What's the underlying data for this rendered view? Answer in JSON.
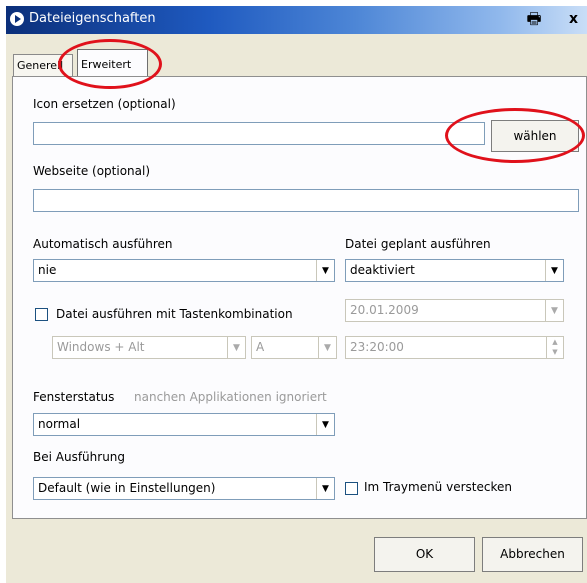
{
  "window": {
    "title": "Dateieigenschaften"
  },
  "tabs": {
    "general": "Generell",
    "advanced": "Erweitert"
  },
  "icon": {
    "label": "Icon ersetzen (optional)",
    "value": "",
    "choose_button": "wählen"
  },
  "website": {
    "label": "Webseite (optional)",
    "value": ""
  },
  "autorun": {
    "label": "Automatisch ausführen",
    "selected": "nie"
  },
  "scheduled": {
    "label": "Datei geplant ausführen",
    "selected": "deaktiviert",
    "date": "20.01.2009",
    "time": "23:20:00"
  },
  "hotkey": {
    "label": "Datei ausführen mit Tastenkombination",
    "modifier": "Windows + Alt",
    "key": "A",
    "checked": false
  },
  "window_state": {
    "label": "Fensterstatus",
    "hint": "nanchen Applikationen ignoriert",
    "selected": "normal"
  },
  "on_execute": {
    "label": "Bei Ausführung",
    "selected": "Default (wie in Einstellungen)"
  },
  "tray": {
    "label": "Im Traymenü verstecken",
    "checked": false
  },
  "buttons": {
    "ok": "OK",
    "cancel": "Abbrechen"
  },
  "icons": {
    "title_logo": "app-logo-icon",
    "print": "printer-icon",
    "close": "close-icon",
    "dropdown": "chevron-down-icon",
    "spin_up": "spin-up-icon",
    "spin_down": "spin-down-icon"
  },
  "annotation_color": "#e0111b"
}
